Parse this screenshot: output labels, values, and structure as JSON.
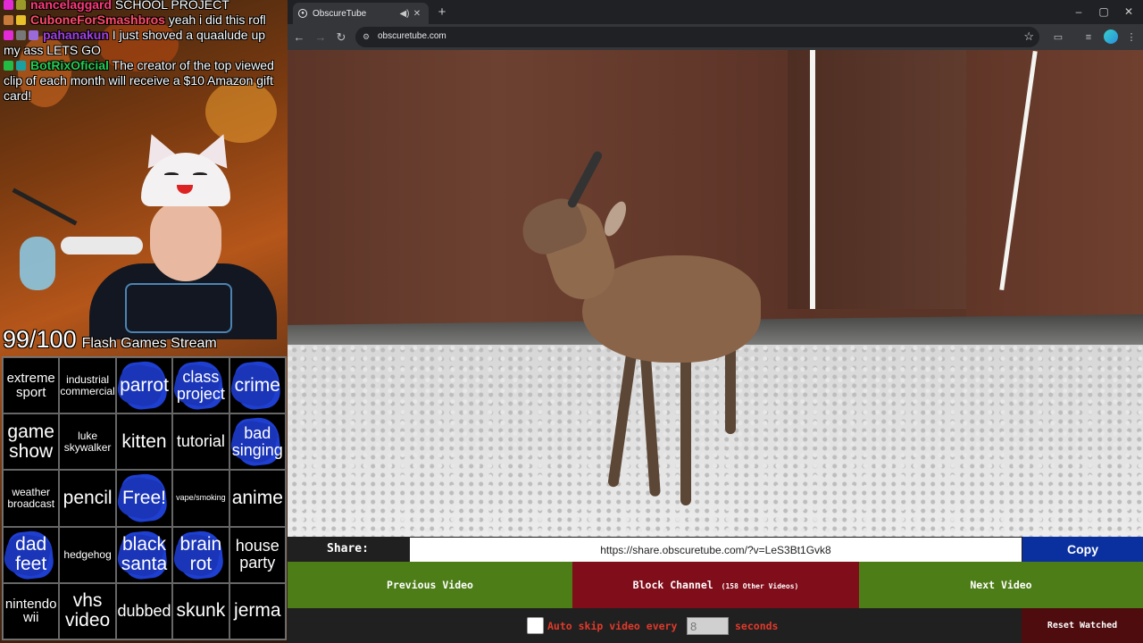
{
  "chat": [
    {
      "badges": [
        "#e22ad6",
        "#9a9a2a"
      ],
      "user": "nancelaggard",
      "user_color": "#ff3a7a",
      "text": "SCHOOL PROJECT"
    },
    {
      "badges": [
        "#c87a3a",
        "#e8c02a"
      ],
      "user": "CuboneForSmashbros",
      "user_color": "#ff4a6a",
      "text": "yeah i did this rofl"
    },
    {
      "badges": [
        "#e22ad6",
        "#777777",
        "#9a6ad8"
      ],
      "user": "pahanakun",
      "user_color": "#a040e0",
      "text": "I just shoved a quaalude up my ass LETS GO"
    },
    {
      "badges": [
        "#22bb44",
        "#1aa0a0"
      ],
      "user": "BotRixOficial",
      "user_color": "#22cc55",
      "text": "The creator of the top viewed clip of each month will receive a $10 Amazon gift card!"
    }
  ],
  "stream": {
    "progress": "99/100",
    "title": "Flash Games Stream"
  },
  "bingo": [
    {
      "text": "extreme sport",
      "size": "m",
      "marked": false
    },
    {
      "text": "industrial commercial",
      "size": "s",
      "marked": false
    },
    {
      "text": "parrot",
      "size": "xl",
      "marked": true
    },
    {
      "text": "class project",
      "size": "l",
      "marked": true
    },
    {
      "text": "crime",
      "size": "xl",
      "marked": true
    },
    {
      "text": "game show",
      "size": "xl",
      "marked": false
    },
    {
      "text": "luke skywalker",
      "size": "s",
      "marked": false
    },
    {
      "text": "kitten",
      "size": "xl",
      "marked": false
    },
    {
      "text": "tutorial",
      "size": "l",
      "marked": false
    },
    {
      "text": "bad singing",
      "size": "l",
      "marked": true
    },
    {
      "text": "weather broadcast",
      "size": "s",
      "marked": false
    },
    {
      "text": "pencil",
      "size": "xl",
      "marked": false
    },
    {
      "text": "Free!",
      "size": "xl",
      "marked": true
    },
    {
      "text": "vape/smoking",
      "size": "xs",
      "marked": false
    },
    {
      "text": "anime",
      "size": "xl",
      "marked": false
    },
    {
      "text": "dad feet",
      "size": "xl",
      "marked": true
    },
    {
      "text": "hedgehog",
      "size": "s",
      "marked": false
    },
    {
      "text": "black santa",
      "size": "xl",
      "marked": true
    },
    {
      "text": "brain rot",
      "size": "xl",
      "marked": true
    },
    {
      "text": "house party",
      "size": "l",
      "marked": false
    },
    {
      "text": "nintendo wii",
      "size": "m",
      "marked": false
    },
    {
      "text": "vhs video",
      "size": "xl",
      "marked": false
    },
    {
      "text": "dubbed",
      "size": "l",
      "marked": false
    },
    {
      "text": "skunk",
      "size": "xl",
      "marked": false
    },
    {
      "text": "jerma",
      "size": "xl",
      "marked": false
    }
  ],
  "browser": {
    "tab_title": "ObscureTube",
    "new_tab": "+",
    "url": "obscuretube.com",
    "window_controls": [
      "–",
      "▢",
      "✕"
    ],
    "icons": [
      "back-arrow-icon",
      "forward-arrow-icon",
      "reload-icon",
      "site-info-icon",
      "bookmark-star-icon",
      "cast-icon",
      "menu-icon"
    ]
  },
  "player": {
    "share_label": "Share:",
    "share_url": "https://share.obscuretube.com/?v=LeS3Bt1Gvk8",
    "copy_label": "Copy",
    "prev_label": "Previous Video",
    "block_label": "Block Channel",
    "block_sub": "(158 Other Videos)",
    "next_label": "Next Video",
    "auto_label": "Auto skip video every",
    "auto_value": "8",
    "auto_suffix": "seconds",
    "auto_checked": false,
    "reset_label": "Reset Watched"
  },
  "colors": {
    "green": "#4d7d17",
    "red": "#800d1a",
    "copy_blue": "#0a2f9e",
    "bingo_mark": "#1e3fd0"
  }
}
